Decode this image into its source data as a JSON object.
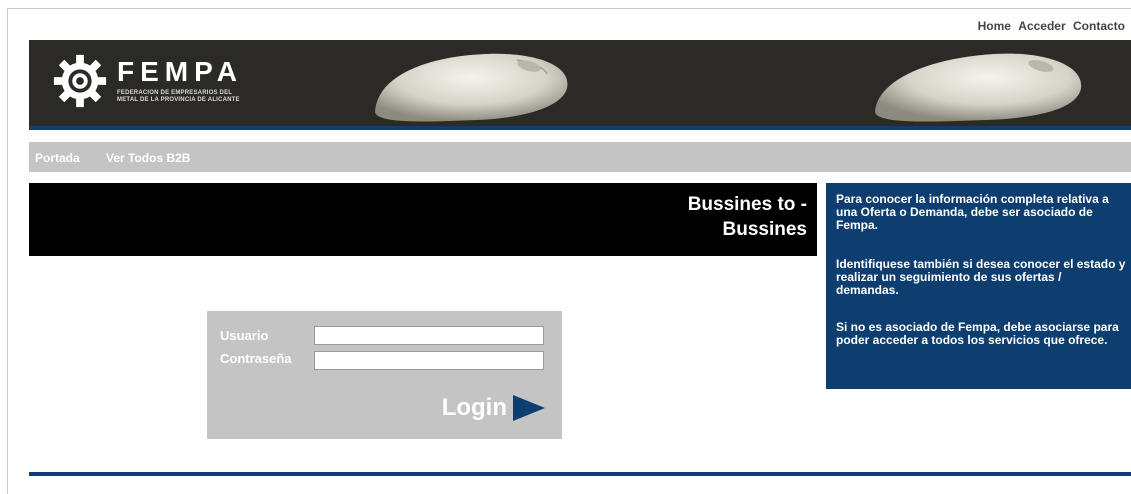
{
  "top_nav": {
    "home": "Home",
    "acceder": "Acceder",
    "contacto": "Contacto"
  },
  "logo": {
    "title": "FEMPA",
    "subtitle_line1": "FEDERACION DE EMPRESARIOS DEL",
    "subtitle_line2": "METAL DE LA PROVINCIA DE ALICANTE"
  },
  "menu": {
    "portada": "Portada",
    "ver_todos": "Ver Todos B2B"
  },
  "header": {
    "title_line1": "Bussines to -",
    "title_line2": "Bussines"
  },
  "info": {
    "p1": "Para conocer la información completa relativa a una Oferta o Demanda, debe ser asociado de Fempa.",
    "p2": "Identifiquese también si desea conocer el estado y realizar un seguimiento de sus ofertas / demandas.",
    "p3": "Si no es asociado de Fempa, debe asociarse para poder acceder a todos los servicios que ofrece."
  },
  "login": {
    "user_label": "Usuario",
    "password_label": "Contraseña",
    "user_value": "",
    "password_value": "",
    "button_label": "Login"
  },
  "colors": {
    "navy": "#0e3e70",
    "banner": "#2b2a27",
    "gray_bar": "#c4c4c4"
  }
}
